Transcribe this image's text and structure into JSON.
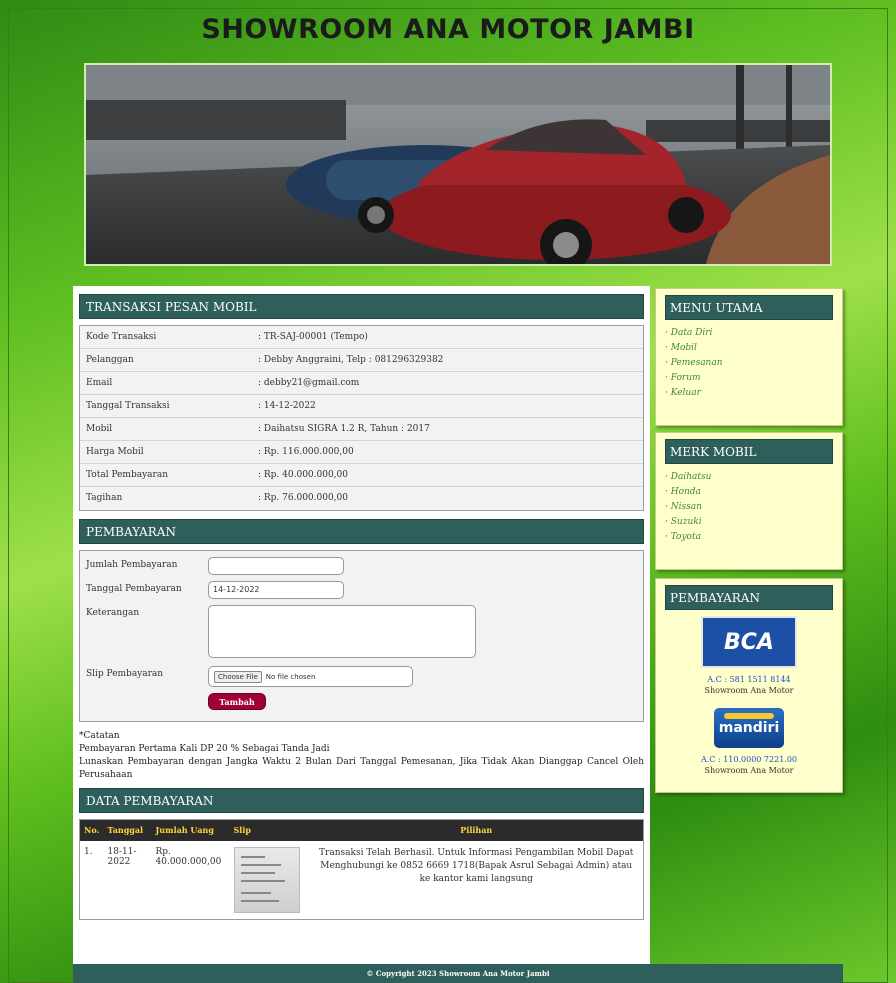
{
  "site_title": "SHOWROOM ANA MOTOR JAMBI",
  "transaksi": {
    "heading": "TRANSAKSI PESAN MOBIL",
    "rows": [
      {
        "label": "Kode Transaksi",
        "value": ": TR-SAJ-00001 (Tempo)"
      },
      {
        "label": "Pelanggan",
        "value": ": Debby Anggraini, Telp : 081296329382"
      },
      {
        "label": "Email",
        "value": ": debby21@gmail.com"
      },
      {
        "label": "Tanggal Transaksi",
        "value": ": 14-12-2022"
      },
      {
        "label": "Mobil",
        "value": ": Daihatsu SIGRA 1.2 R, Tahun : 2017"
      },
      {
        "label": "Harga Mobil",
        "value": ": Rp. 116.000.000,00"
      },
      {
        "label": "Total Pembayaran",
        "value": ": Rp. 40.000.000,00"
      },
      {
        "label": "Tagihan",
        "value": ": Rp. 76.000.000,00"
      }
    ]
  },
  "pembayaran": {
    "heading": "PEMBAYARAN",
    "jumlah_label": "Jumlah Pembayaran",
    "jumlah_value": "",
    "tanggal_label": "Tanggal Pembayaran",
    "tanggal_value": "14-12-2022",
    "keterangan_label": "Keterangan",
    "slip_label": "Slip Pembayaran",
    "file_button": "Choose File",
    "file_status": "No file chosen",
    "submit_label": "Tambah"
  },
  "notes": {
    "line1": "*Catatan",
    "line2": "Pembayaran Pertama Kali DP 20 % Sebagai Tanda Jadi",
    "line3": "Lunaskan Pembayaran dengan Jangka Waktu 2 Bulan Dari Tanggal Pemesanan, Jika Tidak Akan Dianggap Cancel Oleh Perusahaan"
  },
  "data_pembayaran": {
    "heading": "DATA PEMBAYARAN",
    "columns": [
      "No.",
      "Tanggal",
      "Jumlah Uang",
      "Slip",
      "Pilihan"
    ],
    "rows": [
      {
        "no": "1.",
        "tanggal": "18-11-2022",
        "jumlah": "Rp. 40.000.000,00",
        "pilihan": "Transaksi Telah Berhasil. Untuk Informasi Pengambilan Mobil Dapat Menghubungi ke 0852 6669 1718(Bapak Asrul Sebagai Admin) atau ke kantor kami langsung"
      }
    ]
  },
  "footer": "© Copyright 2023 Showroom Ana Motor Jambi",
  "menu_utama": {
    "heading": "MENU UTAMA",
    "items": [
      "Data Diri",
      "Mobil",
      "Pemesanan",
      "Forum",
      "Keluar"
    ]
  },
  "merk_mobil": {
    "heading": "MERK MOBIL",
    "items": [
      "Daihatsu",
      "Honda",
      "Nissan",
      "Suzuki",
      "Toyota"
    ]
  },
  "side_pembayaran": {
    "heading": "PEMBAYARAN",
    "bca_logo": "BCA",
    "bca_ac": "A.C : 581 1511 8144",
    "bca_name": "Showroom Ana Motor",
    "mandiri_logo": "mandiri",
    "mandiri_ac": "A.C : 110.0000 7221.00",
    "mandiri_name": "Showroom Ana Motor"
  }
}
